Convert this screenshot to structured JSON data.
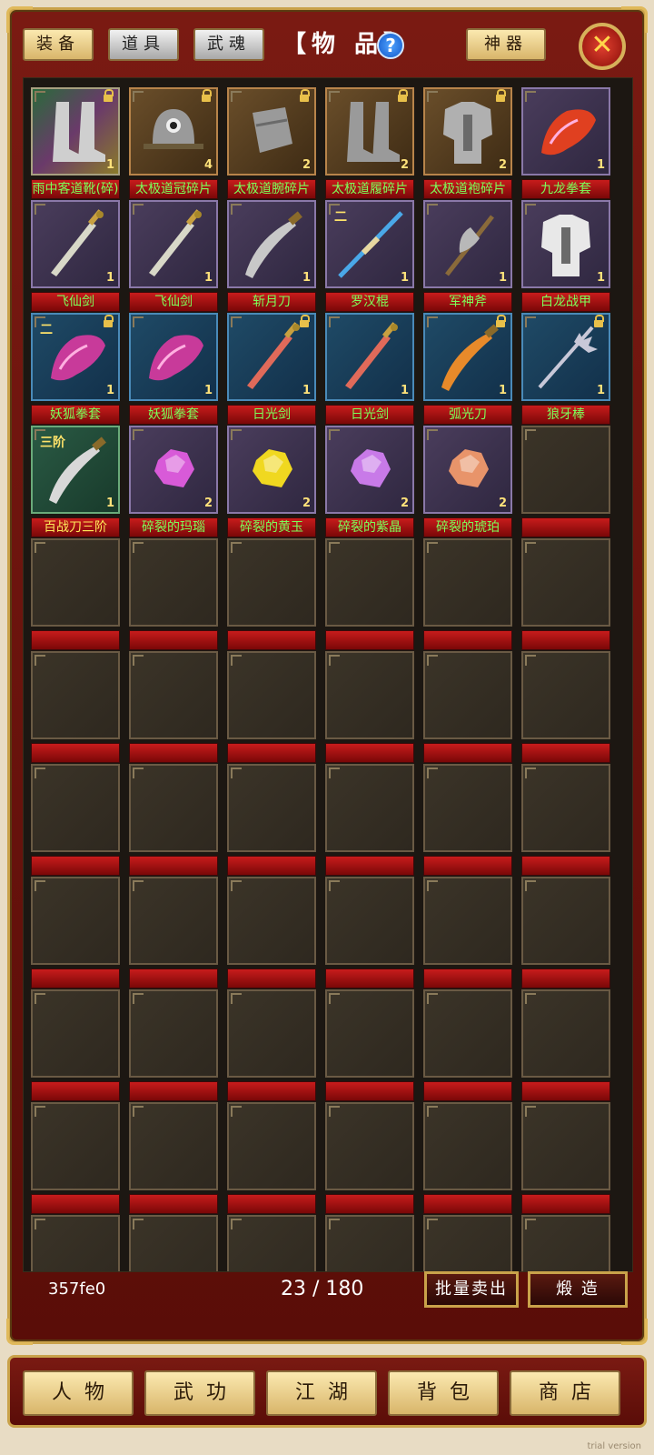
{
  "header": {
    "tabs": [
      {
        "label": "装备",
        "style": "gold"
      },
      {
        "label": "道具",
        "style": "silver"
      },
      {
        "label": "武魂",
        "style": "silver"
      }
    ],
    "title": "【物 品】",
    "help_label": "?",
    "artifact_label": "神器",
    "close_label": "✕"
  },
  "inventory": {
    "items": [
      {
        "name": "雨中客道靴(碎)",
        "count": "1",
        "locked": true,
        "quality": "rainbow",
        "grade": "",
        "icon": "boots-icon",
        "color": "#cfcfcf"
      },
      {
        "name": "太极道冠碎片",
        "count": "4",
        "locked": true,
        "quality": "orange",
        "grade": "",
        "icon": "helmet-icon",
        "color": "#9a9a9a"
      },
      {
        "name": "太极道腕碎片",
        "count": "2",
        "locked": true,
        "quality": "orange",
        "grade": "",
        "icon": "bracer-icon",
        "color": "#9a9a9a"
      },
      {
        "name": "太极道履碎片",
        "count": "2",
        "locked": true,
        "quality": "orange",
        "grade": "",
        "icon": "boots-icon",
        "color": "#9a9a9a"
      },
      {
        "name": "太极道袍碎片",
        "count": "2",
        "locked": true,
        "quality": "orange",
        "grade": "",
        "icon": "armor-icon",
        "color": "#b0b0b0"
      },
      {
        "name": "九龙拳套",
        "count": "1",
        "locked": false,
        "quality": "purple",
        "grade": "",
        "icon": "gauntlet-icon",
        "color": "#e04020"
      },
      {
        "name": "飞仙剑",
        "count": "1",
        "locked": false,
        "quality": "purple",
        "grade": "",
        "icon": "sword-icon",
        "color": "#d8d8c8"
      },
      {
        "name": "飞仙剑",
        "count": "1",
        "locked": false,
        "quality": "purple",
        "grade": "",
        "icon": "sword-icon",
        "color": "#d8d8c8"
      },
      {
        "name": "斩月刀",
        "count": "1",
        "locked": false,
        "quality": "purple",
        "grade": "",
        "icon": "blade-icon",
        "color": "#c8c8c8"
      },
      {
        "name": "罗汉棍",
        "count": "1",
        "locked": false,
        "quality": "purple",
        "grade": "二",
        "icon": "staff-icon",
        "color": "#4aa8e8"
      },
      {
        "name": "军神斧",
        "count": "1",
        "locked": false,
        "quality": "purple",
        "grade": "",
        "icon": "axe-icon",
        "color": "#b8b8b8"
      },
      {
        "name": "白龙战甲",
        "count": "1",
        "locked": false,
        "quality": "purple",
        "grade": "",
        "icon": "armor-icon",
        "color": "#e8e8e8"
      },
      {
        "name": "妖狐拳套",
        "count": "1",
        "locked": true,
        "quality": "blue",
        "grade": "二",
        "icon": "gauntlet-icon",
        "color": "#c83a9a"
      },
      {
        "name": "妖狐拳套",
        "count": "1",
        "locked": false,
        "quality": "blue",
        "grade": "",
        "icon": "gauntlet-icon",
        "color": "#c83a9a"
      },
      {
        "name": "日光剑",
        "count": "1",
        "locked": true,
        "quality": "blue",
        "grade": "",
        "icon": "sword-icon",
        "color": "#e06a5a"
      },
      {
        "name": "日光剑",
        "count": "1",
        "locked": false,
        "quality": "blue",
        "grade": "",
        "icon": "sword-icon",
        "color": "#e06a5a"
      },
      {
        "name": "弧光刀",
        "count": "1",
        "locked": true,
        "quality": "blue",
        "grade": "",
        "icon": "blade-icon",
        "color": "#e88a2a"
      },
      {
        "name": "狼牙棒",
        "count": "1",
        "locked": true,
        "quality": "blue",
        "grade": "",
        "icon": "mace-icon",
        "color": "#c8c8d8"
      },
      {
        "name": "百战刀三阶",
        "count": "1",
        "locked": false,
        "quality": "green",
        "grade": "三阶",
        "icon": "blade-icon",
        "color": "#d8d8d8",
        "label_color": "yellow"
      },
      {
        "name": "碎裂的玛瑙",
        "count": "2",
        "locked": false,
        "quality": "purple",
        "grade": "",
        "icon": "gem-icon",
        "color": "#d85ad8"
      },
      {
        "name": "碎裂的黄玉",
        "count": "2",
        "locked": false,
        "quality": "purple",
        "grade": "",
        "icon": "gem-icon",
        "color": "#f0d820"
      },
      {
        "name": "碎裂的紫晶",
        "count": "2",
        "locked": false,
        "quality": "purple",
        "grade": "",
        "icon": "gem-icon",
        "color": "#c87ae8"
      },
      {
        "name": "碎裂的琥珀",
        "count": "2",
        "locked": false,
        "quality": "purple",
        "grade": "",
        "icon": "gem-icon",
        "color": "#e8946a"
      }
    ]
  },
  "footer": {
    "code": "357fe0",
    "capacity": "23 / 180",
    "batch_sell_label": "批量卖出",
    "forge_label": "煅 造"
  },
  "nav": {
    "items": [
      "人物",
      "武功",
      "江湖",
      "背包",
      "商店"
    ]
  },
  "watermark": "trial version"
}
